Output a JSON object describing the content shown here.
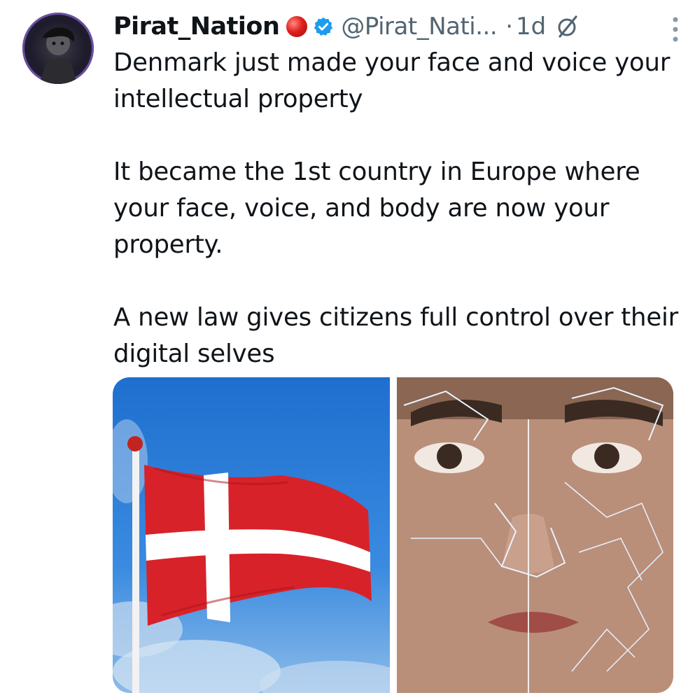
{
  "tweet": {
    "author_name": "Pirat_Nation",
    "handle": "@Pirat_Nati...",
    "separator": "·",
    "time": "1d",
    "paragraphs": [
      "Denmark just made your face and voice your intellectual property",
      "It became the 1st country in Europe where your face, voice, and body are now your property.",
      "A new law gives citizens full control over their digital selves"
    ]
  },
  "icons": {
    "avatar": "profile-avatar",
    "badge_emoji": "red-circle-icon",
    "verified": "verified-badge-icon",
    "grok": "grok-icon",
    "more": "more-options-icon"
  },
  "colors": {
    "text": "#0f1419",
    "secondary": "#536471",
    "verified_blue": "#1d9bf0",
    "flag_red": "#d8222a",
    "sky_blue": "#2e7fd9"
  }
}
